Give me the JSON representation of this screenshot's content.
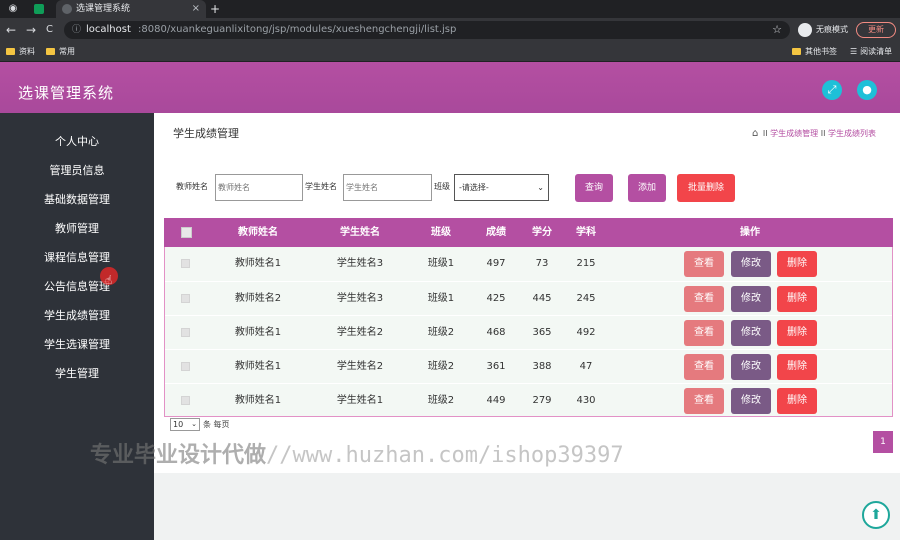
{
  "browser": {
    "tab_title": "选课管理系统",
    "new_tab": "+",
    "tab_close": "×",
    "nav_back": "←",
    "nav_forward": "→",
    "nav_reload": "C",
    "url_host": "localhost",
    "url_path": ":8080/xuankeguanlixitong/jsp/modules/xueshengchengji/list.jsp",
    "incognito_label": "无痕模式",
    "update_label": "更新",
    "bookmarks": [
      "资料",
      "常用"
    ],
    "bookmarks_right": [
      "其他书签",
      "阅读清单"
    ]
  },
  "app": {
    "title": "选课管理系统",
    "header_icons": [
      "fullscreen-icon",
      "user-icon"
    ]
  },
  "sidebar": {
    "items": [
      {
        "label": "个人中心"
      },
      {
        "label": "管理员信息"
      },
      {
        "label": "基础数据管理"
      },
      {
        "label": "教师管理"
      },
      {
        "label": "课程信息管理"
      },
      {
        "label": "公告信息管理"
      },
      {
        "label": "学生成绩管理"
      },
      {
        "label": "学生选课管理"
      },
      {
        "label": "学生管理"
      }
    ]
  },
  "page": {
    "title": "学生成绩管理",
    "breadcrumb": {
      "separator": "II",
      "items": [
        "学生成绩管理",
        "学生成绩列表"
      ]
    }
  },
  "filters": {
    "teacher_label": "教师姓名",
    "teacher_placeholder": "教师姓名",
    "student_label": "学生姓名",
    "student_placeholder": "学生姓名",
    "class_label": "班级",
    "class_selected": "-请选择-",
    "search_button": "查询",
    "add_button": "添加",
    "batch_delete_button": "批量删除"
  },
  "table": {
    "columns": [
      "教师姓名",
      "学生姓名",
      "班级",
      "成绩",
      "学分",
      "学科",
      "操作"
    ],
    "rows": [
      {
        "teacher": "教师姓名1",
        "student": "学生姓名3",
        "class": "班级1",
        "score": "497",
        "credit": "73",
        "subject": "215"
      },
      {
        "teacher": "教师姓名2",
        "student": "学生姓名3",
        "class": "班级1",
        "score": "425",
        "credit": "445",
        "subject": "245"
      },
      {
        "teacher": "教师姓名1",
        "student": "学生姓名2",
        "class": "班级2",
        "score": "468",
        "credit": "365",
        "subject": "492"
      },
      {
        "teacher": "教师姓名1",
        "student": "学生姓名2",
        "class": "班级2",
        "score": "361",
        "credit": "388",
        "subject": "47"
      },
      {
        "teacher": "教师姓名1",
        "student": "学生姓名1",
        "class": "班级2",
        "score": "449",
        "credit": "279",
        "subject": "430"
      }
    ],
    "actions": {
      "view": "查看",
      "edit": "修改",
      "delete": "删除"
    }
  },
  "pagination": {
    "page_size": "10",
    "page_size_suffix": "条 每页",
    "current_page": "1"
  },
  "watermark": {
    "cn": "专业毕业设计代做",
    "url": "//www.huzhan.com/ishop39397"
  },
  "colors": {
    "brand": "#b44fa2",
    "sidebar_bg": "#2e3239",
    "header_icon_bg": "#1ec0d8",
    "view_button": "#e57a7e",
    "edit_button": "#7a5a86",
    "delete_button": "#f2454a"
  }
}
